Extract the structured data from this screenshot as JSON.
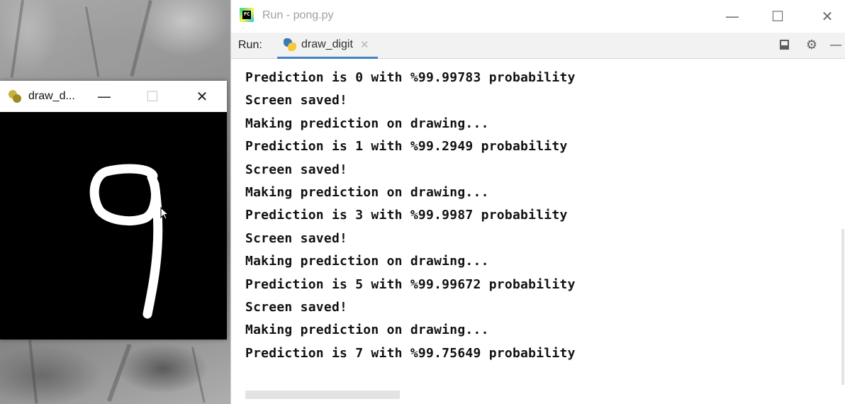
{
  "run_window": {
    "title": "Run - pong.py",
    "minimize_glyph": "—",
    "maximize_glyph": "☐",
    "close_glyph": "✕",
    "toolbar": {
      "run_label": "Run:",
      "tab_label": "draw_digit",
      "tab_close_glyph": "✕",
      "tab_icon": "python-icon",
      "layout_icon": "layout-icon",
      "settings_icon": "gear-icon",
      "settings_glyph": "⚙",
      "more_icon": "minus-icon",
      "more_glyph": "—"
    },
    "console_lines": [
      "Prediction is 0 with %99.99783 probability",
      "Screen saved!",
      "Making prediction on drawing...",
      "Prediction is 1 with %99.2949 probability",
      "Screen saved!",
      "Making prediction on drawing...",
      "Prediction is 3 with %99.9987 probability",
      "Screen saved!",
      "Making prediction on drawing...",
      "Prediction is 5 with %99.99672 probability",
      "Screen saved!",
      "Making prediction on drawing...",
      "Prediction is 7 with %99.75649 probability"
    ]
  },
  "draw_window": {
    "title": "draw_d...",
    "minimize_glyph": "—",
    "maximize_glyph": "☐",
    "close_glyph": "✕",
    "canvas_digit_drawn": "9",
    "colors": {
      "canvas_background": "#000000",
      "stroke": "#ffffff"
    }
  },
  "colors": {
    "tab_underline": "#4083c9",
    "console_text": "#111111",
    "title_inactive": "#a0a0a0"
  }
}
